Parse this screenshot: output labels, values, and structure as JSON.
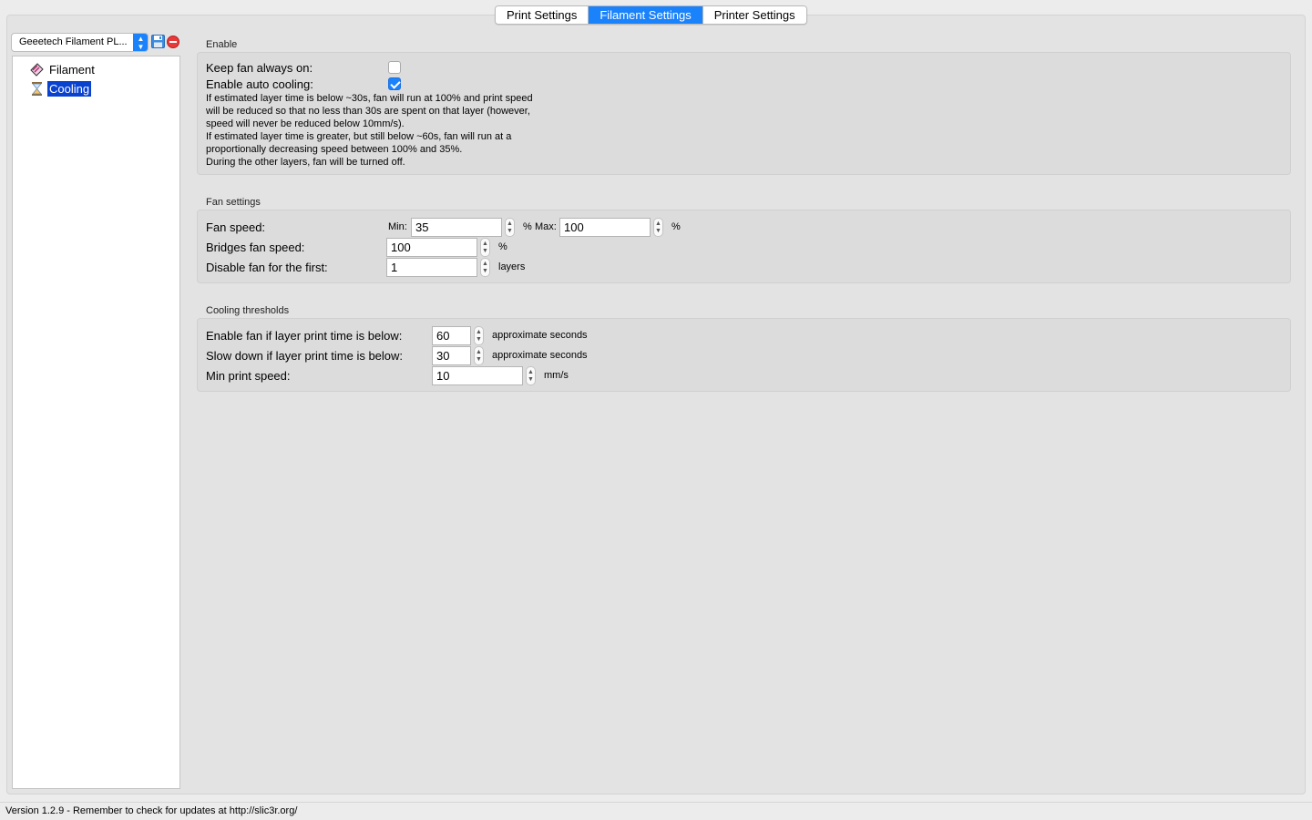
{
  "tabs": [
    {
      "label": "Print Settings",
      "active": false
    },
    {
      "label": "Filament Settings",
      "active": true
    },
    {
      "label": "Printer Settings",
      "active": false
    }
  ],
  "preset": {
    "selected": "Geeetech Filament PL...",
    "save_icon": "floppy-disk-icon",
    "delete_icon": "red-minus-circle-icon"
  },
  "tree": {
    "items": [
      {
        "label": "Filament",
        "icon": "spool-icon",
        "selected": false
      },
      {
        "label": "Cooling",
        "icon": "hourglass-icon",
        "selected": true
      }
    ]
  },
  "enable_group": {
    "title": "Enable",
    "keep_fan_label": "Keep fan always on:",
    "keep_fan_checked": false,
    "auto_cooling_label": "Enable auto cooling:",
    "auto_cooling_checked": true,
    "help_lines": [
      "If estimated layer time is below ~30s, fan will run at 100% and print speed",
      "will be reduced so that no less than 30s are spent on that layer (however,",
      "speed will never be reduced below 10mm/s).",
      "If estimated layer time is greater, but still below ~60s, fan will run at a",
      "proportionally decreasing speed between 100% and 35%.",
      "During the other layers, fan will be turned off."
    ]
  },
  "fan_group": {
    "title": "Fan settings",
    "fan_speed_label": "Fan speed:",
    "min_label": "Min:",
    "min_value": "35",
    "min_unit": "%",
    "max_label": "Max:",
    "max_value": "100",
    "max_unit": "%",
    "bridges_label": "Bridges fan speed:",
    "bridges_value": "100",
    "bridges_unit": "%",
    "disable_label": "Disable fan for the first:",
    "disable_value": "1",
    "disable_unit": "layers"
  },
  "thresholds_group": {
    "title": "Cooling thresholds",
    "enable_fan_label": "Enable fan if layer print time is below:",
    "enable_fan_value": "60",
    "enable_fan_unit": "approximate seconds",
    "slow_down_label": "Slow down if layer print time is below:",
    "slow_down_value": "30",
    "slow_down_unit": "approximate seconds",
    "min_speed_label": "Min print speed:",
    "min_speed_value": "10",
    "min_speed_unit": "mm/s"
  },
  "status_bar": {
    "text": "Version 1.2.9 - Remember to check for updates at http://slic3r.org/"
  },
  "colors": {
    "accent": "#1a82fb",
    "selection": "#0a42d0"
  }
}
